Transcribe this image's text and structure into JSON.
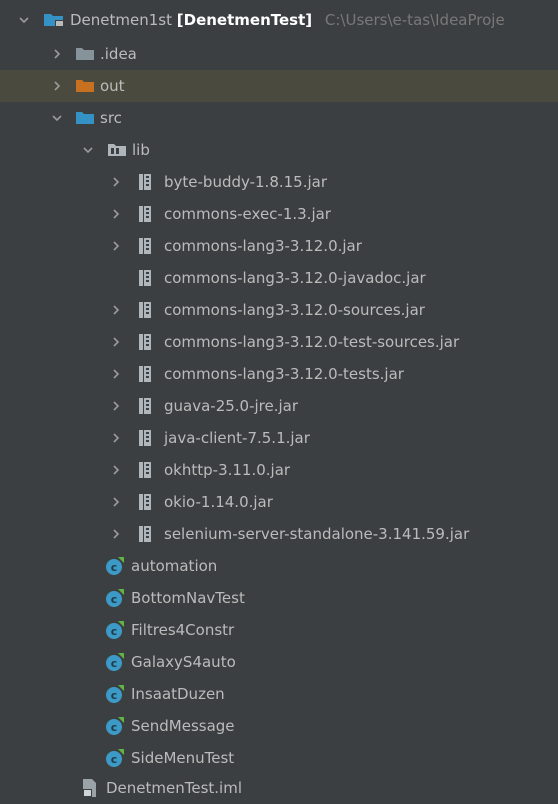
{
  "project_tree": {
    "root": {
      "name": "Denetmen1st",
      "module": "[DenetmenTest]",
      "path": "C:\\Users\\e-tas\\IdeaProje"
    },
    "folders": {
      "idea": ".idea",
      "out": "out",
      "src": "src",
      "lib": "lib"
    },
    "jars": [
      "byte-buddy-1.8.15.jar",
      "commons-exec-1.3.jar",
      "commons-lang3-3.12.0.jar",
      "commons-lang3-3.12.0-javadoc.jar",
      "commons-lang3-3.12.0-sources.jar",
      "commons-lang3-3.12.0-test-sources.jar",
      "commons-lang3-3.12.0-tests.jar",
      "guava-25.0-jre.jar",
      "java-client-7.5.1.jar",
      "okhttp-3.11.0.jar",
      "okio-1.14.0.jar",
      "selenium-server-standalone-3.141.59.jar"
    ],
    "classes": [
      "automation",
      "BottomNavTest",
      "Filtres4Constr",
      "GalaxyS4auto",
      "InsaatDuzen",
      "SendMessage",
      "SideMenuTest"
    ],
    "module_file": "DenetmenTest.iml"
  },
  "colors": {
    "background": "#3c3f41",
    "selected_row": "#4b4a3e",
    "folder_blue": "#3592c4",
    "folder_orange": "#c7701f",
    "class_icon": "#3d9ac6"
  }
}
